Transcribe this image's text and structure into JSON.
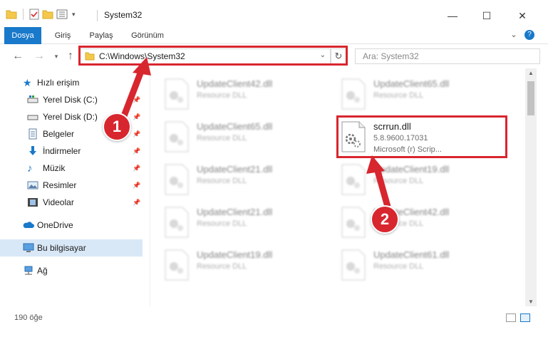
{
  "window": {
    "title": "System32",
    "controls": {
      "minimize": "—",
      "maximize": "☐",
      "close": "✕"
    }
  },
  "ribbon": {
    "tabs": [
      "Dosya",
      "Giriş",
      "Paylaş",
      "Görünüm"
    ],
    "help": "?"
  },
  "address_bar": {
    "path": "C:\\Windows\\System32",
    "search_placeholder": "Ara: System32"
  },
  "nav_pane": {
    "quick_access": "Hızlı erişim",
    "items": [
      {
        "label": "Yerel Disk (C:)",
        "icon": "drive-icon",
        "pinned": true
      },
      {
        "label": "Yerel Disk (D:)",
        "icon": "drive-icon",
        "pinned": true
      },
      {
        "label": "Belgeler",
        "icon": "documents-icon",
        "pinned": true
      },
      {
        "label": "İndirmeler",
        "icon": "downloads-icon",
        "pinned": true
      },
      {
        "label": "Müzik",
        "icon": "music-icon",
        "pinned": true
      },
      {
        "label": "Resimler",
        "icon": "pictures-icon",
        "pinned": true
      },
      {
        "label": "Videolar",
        "icon": "videos-icon",
        "pinned": true
      }
    ],
    "onedrive": "OneDrive",
    "this_pc": "Bu bilgisayar",
    "network": "Ağ"
  },
  "files": {
    "left": [
      {
        "name": "UpdateClient42.dll",
        "type": "Resource DLL"
      },
      {
        "name": "UpdateClient65.dll",
        "type": "Resource DLL"
      },
      {
        "name": "UpdateClient21.dll",
        "type": "Resource DLL"
      },
      {
        "name": "UpdateClient21.dll",
        "type": "Resource DLL"
      },
      {
        "name": "UpdateClient19.dll",
        "type": "Resource DLL"
      }
    ],
    "right": [
      {
        "name": "UpdateClient65.dll",
        "type": "Resource DLL"
      },
      {
        "name": "UpdateClient19.dll",
        "type": "Resource DLL"
      },
      {
        "name": "UpdateClient42.dll",
        "type": "Resource DLL"
      },
      {
        "name": "UpdateClient61.dll",
        "type": "Resource DLL"
      }
    ],
    "highlighted": {
      "name": "scrrun.dll",
      "version": "5.8.9600.17031",
      "description": "Microsoft (r) Scrip..."
    }
  },
  "status": {
    "item_count": "190 öğe"
  },
  "markers": [
    "1",
    "2"
  ],
  "colors": {
    "accent": "#1979ca",
    "highlight_red": "#d8262f",
    "selected_bg": "#d9e8f7"
  }
}
